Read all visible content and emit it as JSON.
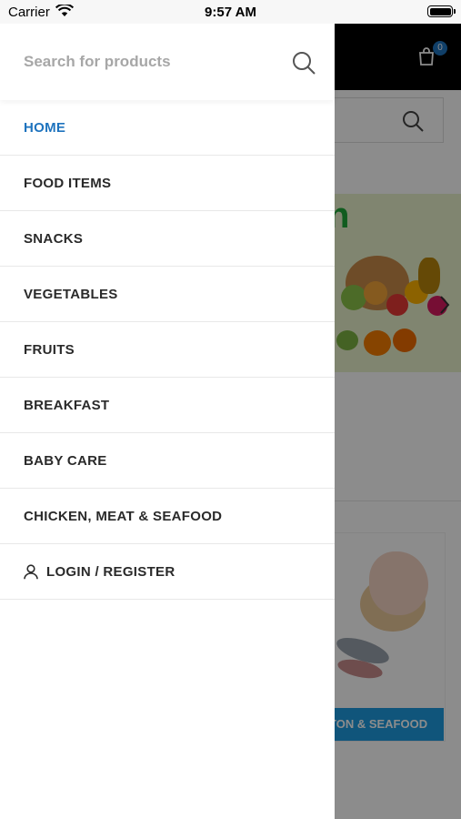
{
  "status_bar": {
    "carrier": "Carrier",
    "time": "9:57 AM"
  },
  "drawer": {
    "search": {
      "placeholder": "Search for products",
      "value": ""
    },
    "menu": [
      {
        "label": "HOME",
        "active": true
      },
      {
        "label": "FOOD ITEMS",
        "active": false
      },
      {
        "label": "SNACKS",
        "active": false
      },
      {
        "label": "VEGETABLES",
        "active": false
      },
      {
        "label": "FRUITS",
        "active": false
      },
      {
        "label": "BREAKFAST",
        "active": false
      },
      {
        "label": "BABY CARE",
        "active": false
      },
      {
        "label": "CHICKEN, MEAT & SEAFOOD",
        "active": false
      }
    ],
    "login_label": "LOGIN / REGISTER"
  },
  "background": {
    "cart_count": "0",
    "banner_text": "n",
    "category_label": "TON & SEAFOOD"
  },
  "colors": {
    "accent": "#1e73be",
    "header": "#000000",
    "category_label_bg": "#1e9be0"
  },
  "icons": [
    "wifi-icon",
    "battery-icon",
    "search-icon",
    "cart-icon",
    "chevron-right-icon",
    "user-icon"
  ]
}
